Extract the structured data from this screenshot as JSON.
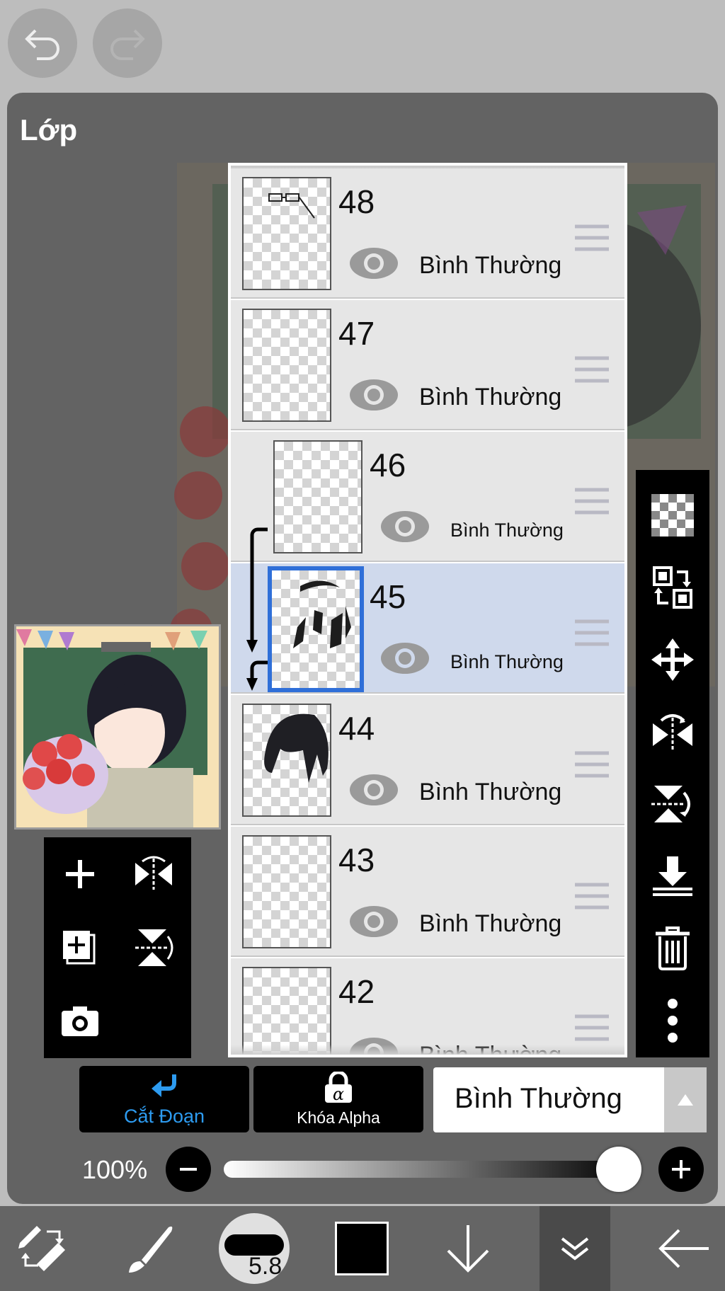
{
  "panel": {
    "title": "Lớp"
  },
  "layers": [
    {
      "number": "48",
      "mode": "Bình Thường"
    },
    {
      "number": "47",
      "mode": "Bình Thường"
    },
    {
      "number": "46",
      "mode": "Bình Thường"
    },
    {
      "number": "45",
      "mode": "Bình Thường"
    },
    {
      "number": "44",
      "mode": "Bình Thường"
    },
    {
      "number": "43",
      "mode": "Bình Thường"
    },
    {
      "number": "42",
      "mode": "Bình Thường"
    }
  ],
  "selected_layer": "45",
  "buttons": {
    "clipping": "Cắt Đoạn",
    "alpha_lock": "Khóa Alpha"
  },
  "blend_mode": "Bình Thường",
  "opacity": {
    "label": "100%",
    "value": 100
  },
  "brush_size": "5.8",
  "colors": {
    "accent": "#2f6fd8",
    "clipping_icon": "#2d9bf0",
    "selected_row": "#cfd9ec",
    "current_color": "#000000"
  }
}
